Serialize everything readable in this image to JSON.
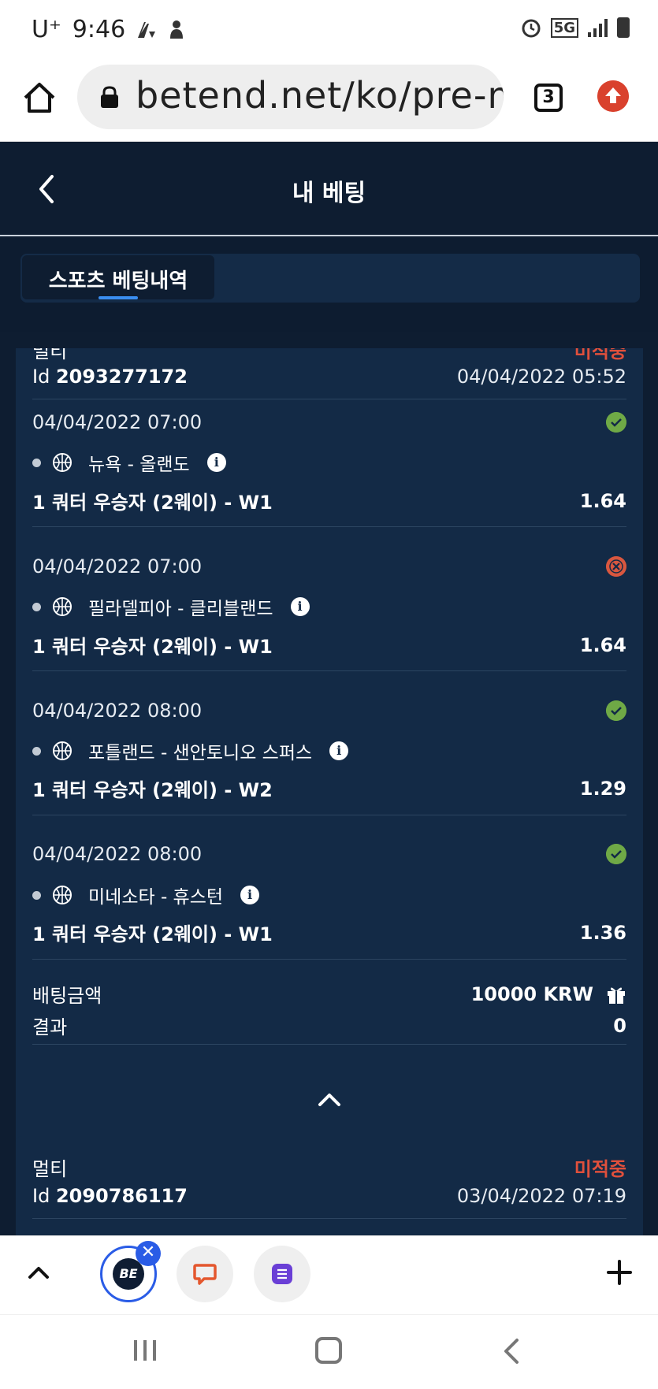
{
  "status_bar": {
    "carrier": "U⁺",
    "time": "9:46",
    "network": "5G"
  },
  "browser": {
    "url": "betend.net/ko/pre-m",
    "tab_count": "3"
  },
  "header": {
    "title": "내 베팅"
  },
  "tabs": [
    {
      "label": "스포츠 베팅내역",
      "active": true
    }
  ],
  "bets": [
    {
      "type": "멀티",
      "status": "미적중",
      "id_label": "Id",
      "id": "2093277172",
      "date": "04/04/2022 05:52",
      "selections": [
        {
          "date": "04/04/2022 07:00",
          "match": "뉴욕 - 올랜도",
          "market": "1 쿼터 우승자 (2웨이) - W1",
          "odds": "1.64",
          "result": "won",
          "sport_icon": "basketball-icon"
        },
        {
          "date": "04/04/2022 07:00",
          "match": "필라델피아 - 클리블랜드",
          "market": "1 쿼터 우승자 (2웨이) - W1",
          "odds": "1.64",
          "result": "lost",
          "sport_icon": "basketball-icon"
        },
        {
          "date": "04/04/2022 08:00",
          "match": "포틀랜드 - 샌안토니오 스퍼스",
          "market": "1 쿼터 우승자 (2웨이) - W2",
          "odds": "1.29",
          "result": "won",
          "sport_icon": "basketball-icon"
        },
        {
          "date": "04/04/2022 08:00",
          "match": "미네소타 - 휴스턴",
          "market": "1 쿼터 우승자 (2웨이) - W1",
          "odds": "1.36",
          "result": "won",
          "sport_icon": "basketball-icon"
        }
      ],
      "stake_label": "배팅금액",
      "stake": "10000 KRW",
      "result_label": "결과",
      "result": "0"
    },
    {
      "type": "멀티",
      "status": "미적중",
      "id_label": "Id",
      "id": "2090786117",
      "date": "03/04/2022 07:19"
    }
  ],
  "colors": {
    "page_bg": "#0e1d31",
    "card_bg": "#132a46",
    "status_lost": "#e0503c",
    "result_won": "#6fa946",
    "result_lost": "#d9573f",
    "tab_accent": "#3a8ef0"
  },
  "toolbar": {
    "app_badge": "BE"
  }
}
